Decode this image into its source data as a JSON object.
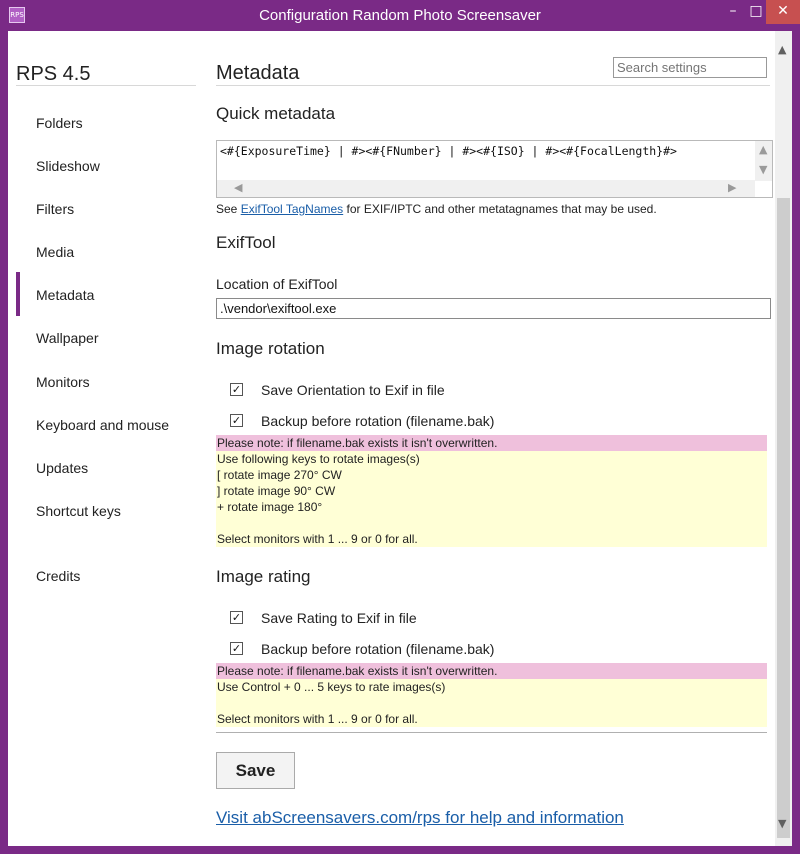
{
  "window": {
    "title": "Configuration Random Photo Screensaver",
    "icon_label": "RPS",
    "minimize_glyph": "–",
    "maximize_glyph": "□",
    "close_glyph": "✕"
  },
  "sidebar": {
    "brand": "RPS 4.5",
    "items": [
      {
        "label": "Folders"
      },
      {
        "label": "Slideshow"
      },
      {
        "label": "Filters"
      },
      {
        "label": "Media"
      },
      {
        "label": "Metadata"
      },
      {
        "label": "Wallpaper"
      },
      {
        "label": "Monitors"
      },
      {
        "label": "Keyboard and mouse"
      },
      {
        "label": "Updates"
      },
      {
        "label": "Shortcut keys"
      },
      {
        "label": "Credits"
      }
    ],
    "active_index": 4
  },
  "search": {
    "placeholder": "Search settings"
  },
  "main": {
    "title": "Metadata",
    "quick_metadata": {
      "heading": "Quick metadata",
      "value": "<#{ExposureTime} | #><#{FNumber} | #><#{ISO} | #><#{FocalLength}#>",
      "hint_prefix": "See ",
      "hint_link": "ExifTool TagNames",
      "hint_suffix": " for EXIF/IPTC and other metatagnames that may be used."
    },
    "exiftool": {
      "heading": "ExifTool",
      "location_label": "Location of ExifTool",
      "location_value": ".\\vendor\\exiftool.exe"
    },
    "image_rotation": {
      "heading": "Image rotation",
      "checks": [
        {
          "label": "Save Orientation to Exif in file",
          "checked": true
        },
        {
          "label": "Backup before rotation (filename.bak)",
          "checked": true
        }
      ],
      "note": "Please note: if filename.bak exists it isn't overwritten.",
      "info": [
        "Use following keys to rotate images(s)",
        "[ rotate image 270° CW",
        "] rotate image 90° CW",
        "+ rotate image 180°",
        "",
        "Select monitors with 1 ... 9 or 0 for all."
      ]
    },
    "image_rating": {
      "heading": "Image rating",
      "checks": [
        {
          "label": "Save Rating to Exif in file",
          "checked": true
        },
        {
          "label": "Backup before rotation (filename.bak)",
          "checked": true
        }
      ],
      "note": "Please note: if filename.bak exists it isn't overwritten.",
      "info": [
        "Use Control + 0 ... 5 keys to rate images(s)",
        "",
        "Select monitors with 1 ... 9 or 0 for all."
      ]
    },
    "save_label": "Save",
    "help_link": "Visit abScreensavers.com/rps for help and information"
  },
  "colors": {
    "accent": "#7a2a86",
    "note_bg": "#efc0dc",
    "info_bg": "#ffffd6",
    "link": "#1a5ea8"
  }
}
